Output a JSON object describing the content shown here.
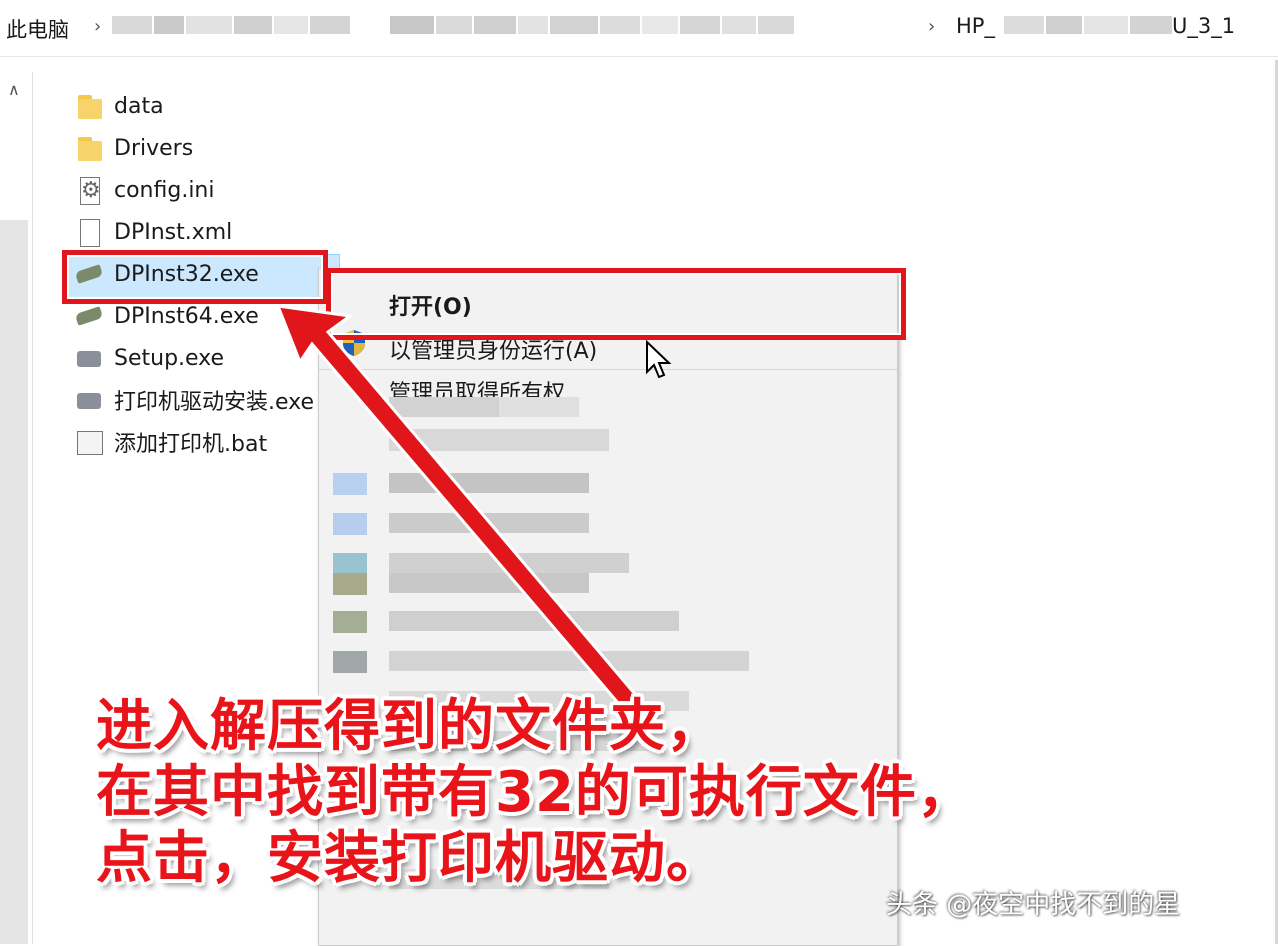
{
  "breadcrumb": {
    "root": "此电脑",
    "last": "HP_",
    "last_suffix": "U_3_1"
  },
  "files": [
    {
      "name": "data",
      "icon": "folder-icon"
    },
    {
      "name": "Drivers",
      "icon": "folder-icon"
    },
    {
      "name": "config.ini",
      "icon": "settings-file-icon"
    },
    {
      "name": "DPInst.xml",
      "icon": "document-icon"
    },
    {
      "name": "DPInst32.exe",
      "icon": "installer-icon",
      "selected": true
    },
    {
      "name": "DPInst64.exe",
      "icon": "installer-icon"
    },
    {
      "name": "Setup.exe",
      "icon": "printer-setup-icon"
    },
    {
      "name": "打印机驱动安装.exe",
      "icon": "printer-setup-icon"
    },
    {
      "name": "添加打印机.bat",
      "icon": "batch-file-icon"
    }
  ],
  "context_menu": {
    "open": "打开(O)",
    "run_as_admin": "以管理员身份运行(A)",
    "take_ownership": "管理员取得所有权"
  },
  "caption": {
    "line1": "进入解压得到的文件夹，",
    "line2": "在其中找到带有32的可执行文件，",
    "line3": "点击，安装打印机驱动。"
  },
  "watermark": "头条 @夜空中找不到的星",
  "colors": {
    "annotation_red": "#e0161b",
    "selection_blue": "#cce8ff",
    "menu_bg": "#f2f2f2"
  }
}
